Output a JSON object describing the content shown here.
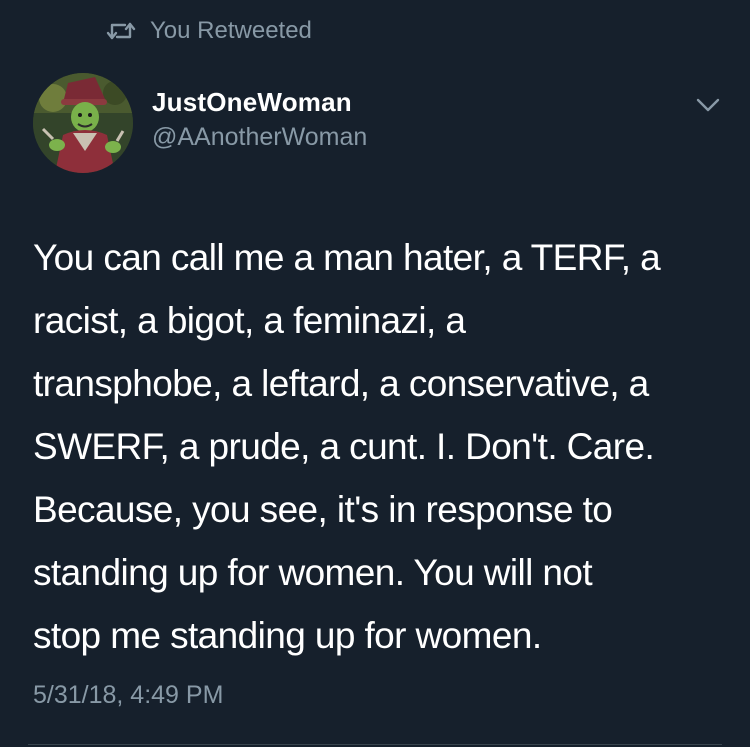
{
  "retweet": {
    "icon": "retweet-icon",
    "label": "You Retweeted"
  },
  "author": {
    "display_name": "JustOneWoman",
    "handle": "@AAnotherWoman",
    "avatar": "avatar"
  },
  "menu": {
    "icon": "chevron-down-icon"
  },
  "tweet": {
    "lines": [
      "You can call me a man hater, a TERF, a",
      "racist, a bigot, a feminazi, a",
      "transphobe, a leftard, a conservative, a",
      "SWERF, a prude, a cunt. I. Don't. Care.",
      "Because, you see, it's in response to",
      "standing up for women. You will not",
      "stop me standing up for women."
    ],
    "timestamp": "5/31/18, 4:49 PM"
  },
  "colors": {
    "background": "#16202c",
    "primary_text": "#ffffff",
    "secondary_text": "#8899a6",
    "divider": "#38444d"
  }
}
